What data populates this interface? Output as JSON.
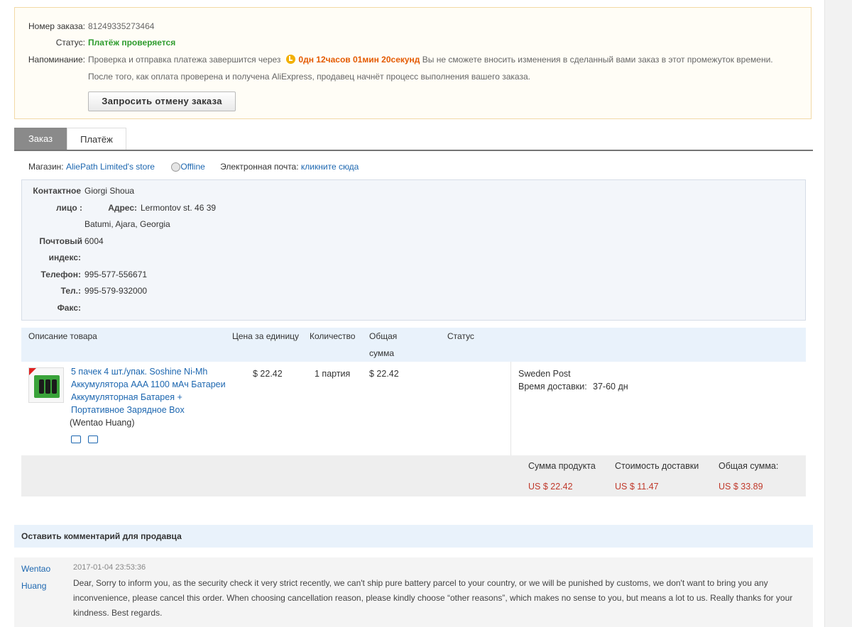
{
  "order_info": {
    "order_no_label": "Номер заказа:",
    "order_no": "81249335273464",
    "status_label": "Статус:",
    "status": "Платёж проверяется",
    "reminder_label": "Напоминание:",
    "reminder_before": "Проверка и отправка платежа завершится через",
    "countdown": "0дн 12часов 01мин 20секунд",
    "reminder_after": "Вы не сможете вносить изменения в сделанный вами заказ в этот промежуток времени. После того, как оплата проверена и получена AliExpress, продавец начнёт процесс выполнения вашего заказа.",
    "cancel_button": "Запросить отмену заказа"
  },
  "tabs": {
    "order": "Заказ",
    "payment": "Платёж"
  },
  "store": {
    "label": "Магазин:",
    "name": "AliePath Limited's store",
    "online_status": "Offline",
    "email_label": "Электронная почта:",
    "email_link": "кликните сюда"
  },
  "address": {
    "contact_label_1": "Контактное",
    "contact_label_2": "лицо :",
    "contact": "Giorgi Shoua",
    "address_label": "Адрес:",
    "address_line1": "Lermontov st. 46 39",
    "address_line2": "Batumi, Ajara, Georgia",
    "zip_label_1": "Почтовый",
    "zip_label_2": "индекс:",
    "zip": "6004",
    "phone_label": "Телефон:",
    "phone": "995-577-556671",
    "tel_label": "Тел.:",
    "tel": "995-579-932000",
    "fax_label": "Факс:",
    "fax": ""
  },
  "table": {
    "headers": {
      "description": "Описание товара",
      "unit_price": "Цена за единицу",
      "quantity": "Количество",
      "total_1": "Общая",
      "total_2": "сумма",
      "status": "Статус"
    },
    "product": {
      "title": "5 пачек 4 шт./упак. Soshine Ni-Mh Аккумулятора AAA 1100 мАч Батареи Аккумуляторная Батарея + Портативное Зарядное Box",
      "seller": "(Wentao Huang)",
      "unit_price": "$ 22.42",
      "quantity": "1 партия",
      "total": "$ 22.42",
      "shipping_method": "Sweden Post",
      "delivery_label": "Время доставки:",
      "delivery_time": "37-60 дн"
    }
  },
  "summary": {
    "product_sum_label": "Сумма продукта",
    "product_sum": "US $ 22.42",
    "shipping_cost_label": "Стоимость доставки",
    "shipping_cost": "US $ 11.47",
    "total_label": "Общая сумма:",
    "total": "US $ 33.89"
  },
  "comments": {
    "header": "Оставить комментарий для продавца",
    "author_1": "Wentao",
    "author_2": "Huang",
    "date": "2017-01-04 23:53:36",
    "text": "Dear, Sorry to inform you, as the security check it very strict recently, we can't ship pure battery parcel to your country, or we will be punished by customs, we don't want to bring you any inconvenience, please cancel this order. When choosing cancellation reason, please kindly choose “other reasons”, which makes no sense to you, but means a lot to us. Really thanks for your kindness. Best regards."
  },
  "colors": {
    "link": "#1d67b0",
    "status_green": "#2e9c2e",
    "countdown_orange": "#e45a00",
    "price_red": "#c0392b"
  }
}
